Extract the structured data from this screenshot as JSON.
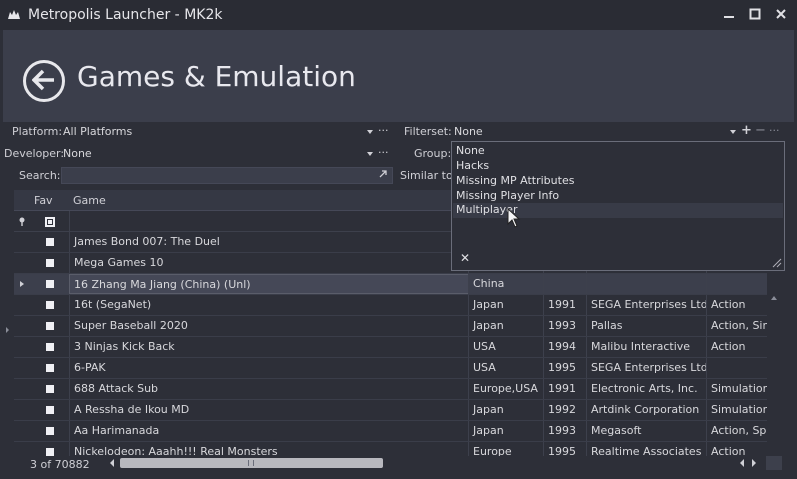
{
  "window": {
    "title": "Metropolis Launcher - MK2k",
    "minimize_icon": "minimize-icon",
    "maximize_icon": "maximize-icon",
    "close_icon": "close-icon"
  },
  "header": {
    "title": "Games & Emulation",
    "back_icon": "back-arrow-icon"
  },
  "filters": {
    "platform_label": "Platform:",
    "platform_value": "All Platforms",
    "developer_label": "Developer:",
    "developer_value": "None",
    "search_label": "Search:",
    "search_value": "",
    "filterset_label": "Filterset:",
    "filterset_value": "None",
    "group_label": "Group:",
    "similar_label": "Similar to:",
    "more": "···",
    "add": "+",
    "remove": "−"
  },
  "grid": {
    "columns": [
      "Fav",
      "Game"
    ],
    "rows": [
      {
        "game": "James Bond 007: The Duel",
        "region": "",
        "year": "",
        "publisher": "",
        "genre": ""
      },
      {
        "game": "Mega Games 10",
        "region": "",
        "year": "",
        "publisher": "",
        "genre": ""
      },
      {
        "game": "16 Zhang Ma Jiang (China) (Unl)",
        "region": "China",
        "year": "",
        "publisher": "",
        "genre": ""
      },
      {
        "game": "16t (SegaNet)",
        "region": "Japan",
        "year": "1991",
        "publisher": "SEGA Enterprises Ltd.",
        "genre": "Action"
      },
      {
        "game": "Super Baseball 2020",
        "region": "Japan",
        "year": "1993",
        "publisher": "Pallas",
        "genre": "Action, Simu"
      },
      {
        "game": "3 Ninjas Kick Back",
        "region": "USA",
        "year": "1994",
        "publisher": "Malibu Interactive",
        "genre": "Action"
      },
      {
        "game": "6-PAK",
        "region": "USA",
        "year": "1995",
        "publisher": "SEGA Enterprises Ltd.",
        "genre": ""
      },
      {
        "game": "688 Attack Sub",
        "region": "Europe,USA",
        "year": "1991",
        "publisher": "Electronic Arts, Inc.",
        "genre": "Simulation"
      },
      {
        "game": "A Ressha de Ikou MD",
        "region": "Japan",
        "year": "1992",
        "publisher": "Artdink Corporation",
        "genre": "Simulation,"
      },
      {
        "game": "Aa Harimanada",
        "region": "Japan",
        "year": "1993",
        "publisher": "Megasoft",
        "genre": "Action, Spo"
      },
      {
        "game": "Nickelodeon: Aaahh!!! Real Monsters",
        "region": "Europe",
        "year": "1995",
        "publisher": "Realtime Associates",
        "genre": "Action"
      }
    ]
  },
  "status": {
    "count": "3 of 70882"
  },
  "popup": {
    "items": [
      "None",
      "Hacks",
      "Missing MP Attributes",
      "Missing Player Info",
      "Multiplayer"
    ],
    "close": "✕"
  },
  "colors": {
    "background": "#2d2f38",
    "header": "#3b3e4b",
    "text": "#d8d8dc"
  }
}
